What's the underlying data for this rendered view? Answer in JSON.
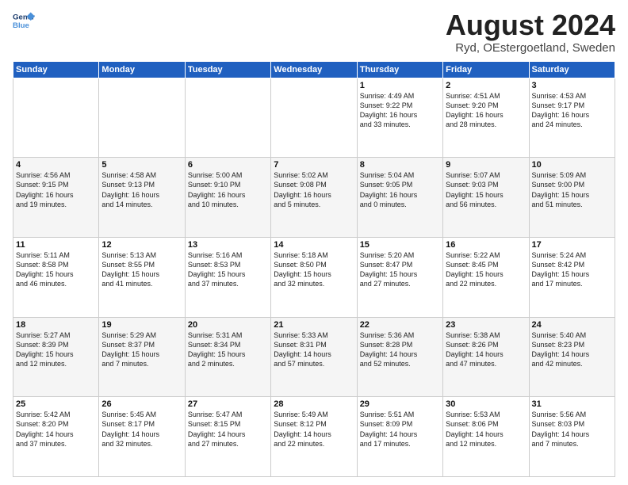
{
  "logo": {
    "line1": "General",
    "line2": "Blue"
  },
  "title": "August 2024",
  "subtitle": "Ryd, OEstergoetland, Sweden",
  "days_of_week": [
    "Sunday",
    "Monday",
    "Tuesday",
    "Wednesday",
    "Thursday",
    "Friday",
    "Saturday"
  ],
  "weeks": [
    [
      {
        "day": "",
        "info": ""
      },
      {
        "day": "",
        "info": ""
      },
      {
        "day": "",
        "info": ""
      },
      {
        "day": "",
        "info": ""
      },
      {
        "day": "1",
        "info": "Sunrise: 4:49 AM\nSunset: 9:22 PM\nDaylight: 16 hours\nand 33 minutes."
      },
      {
        "day": "2",
        "info": "Sunrise: 4:51 AM\nSunset: 9:20 PM\nDaylight: 16 hours\nand 28 minutes."
      },
      {
        "day": "3",
        "info": "Sunrise: 4:53 AM\nSunset: 9:17 PM\nDaylight: 16 hours\nand 24 minutes."
      }
    ],
    [
      {
        "day": "4",
        "info": "Sunrise: 4:56 AM\nSunset: 9:15 PM\nDaylight: 16 hours\nand 19 minutes."
      },
      {
        "day": "5",
        "info": "Sunrise: 4:58 AM\nSunset: 9:13 PM\nDaylight: 16 hours\nand 14 minutes."
      },
      {
        "day": "6",
        "info": "Sunrise: 5:00 AM\nSunset: 9:10 PM\nDaylight: 16 hours\nand 10 minutes."
      },
      {
        "day": "7",
        "info": "Sunrise: 5:02 AM\nSunset: 9:08 PM\nDaylight: 16 hours\nand 5 minutes."
      },
      {
        "day": "8",
        "info": "Sunrise: 5:04 AM\nSunset: 9:05 PM\nDaylight: 16 hours\nand 0 minutes."
      },
      {
        "day": "9",
        "info": "Sunrise: 5:07 AM\nSunset: 9:03 PM\nDaylight: 15 hours\nand 56 minutes."
      },
      {
        "day": "10",
        "info": "Sunrise: 5:09 AM\nSunset: 9:00 PM\nDaylight: 15 hours\nand 51 minutes."
      }
    ],
    [
      {
        "day": "11",
        "info": "Sunrise: 5:11 AM\nSunset: 8:58 PM\nDaylight: 15 hours\nand 46 minutes."
      },
      {
        "day": "12",
        "info": "Sunrise: 5:13 AM\nSunset: 8:55 PM\nDaylight: 15 hours\nand 41 minutes."
      },
      {
        "day": "13",
        "info": "Sunrise: 5:16 AM\nSunset: 8:53 PM\nDaylight: 15 hours\nand 37 minutes."
      },
      {
        "day": "14",
        "info": "Sunrise: 5:18 AM\nSunset: 8:50 PM\nDaylight: 15 hours\nand 32 minutes."
      },
      {
        "day": "15",
        "info": "Sunrise: 5:20 AM\nSunset: 8:47 PM\nDaylight: 15 hours\nand 27 minutes."
      },
      {
        "day": "16",
        "info": "Sunrise: 5:22 AM\nSunset: 8:45 PM\nDaylight: 15 hours\nand 22 minutes."
      },
      {
        "day": "17",
        "info": "Sunrise: 5:24 AM\nSunset: 8:42 PM\nDaylight: 15 hours\nand 17 minutes."
      }
    ],
    [
      {
        "day": "18",
        "info": "Sunrise: 5:27 AM\nSunset: 8:39 PM\nDaylight: 15 hours\nand 12 minutes."
      },
      {
        "day": "19",
        "info": "Sunrise: 5:29 AM\nSunset: 8:37 PM\nDaylight: 15 hours\nand 7 minutes."
      },
      {
        "day": "20",
        "info": "Sunrise: 5:31 AM\nSunset: 8:34 PM\nDaylight: 15 hours\nand 2 minutes."
      },
      {
        "day": "21",
        "info": "Sunrise: 5:33 AM\nSunset: 8:31 PM\nDaylight: 14 hours\nand 57 minutes."
      },
      {
        "day": "22",
        "info": "Sunrise: 5:36 AM\nSunset: 8:28 PM\nDaylight: 14 hours\nand 52 minutes."
      },
      {
        "day": "23",
        "info": "Sunrise: 5:38 AM\nSunset: 8:26 PM\nDaylight: 14 hours\nand 47 minutes."
      },
      {
        "day": "24",
        "info": "Sunrise: 5:40 AM\nSunset: 8:23 PM\nDaylight: 14 hours\nand 42 minutes."
      }
    ],
    [
      {
        "day": "25",
        "info": "Sunrise: 5:42 AM\nSunset: 8:20 PM\nDaylight: 14 hours\nand 37 minutes."
      },
      {
        "day": "26",
        "info": "Sunrise: 5:45 AM\nSunset: 8:17 PM\nDaylight: 14 hours\nand 32 minutes."
      },
      {
        "day": "27",
        "info": "Sunrise: 5:47 AM\nSunset: 8:15 PM\nDaylight: 14 hours\nand 27 minutes."
      },
      {
        "day": "28",
        "info": "Sunrise: 5:49 AM\nSunset: 8:12 PM\nDaylight: 14 hours\nand 22 minutes."
      },
      {
        "day": "29",
        "info": "Sunrise: 5:51 AM\nSunset: 8:09 PM\nDaylight: 14 hours\nand 17 minutes."
      },
      {
        "day": "30",
        "info": "Sunrise: 5:53 AM\nSunset: 8:06 PM\nDaylight: 14 hours\nand 12 minutes."
      },
      {
        "day": "31",
        "info": "Sunrise: 5:56 AM\nSunset: 8:03 PM\nDaylight: 14 hours\nand 7 minutes."
      }
    ]
  ]
}
